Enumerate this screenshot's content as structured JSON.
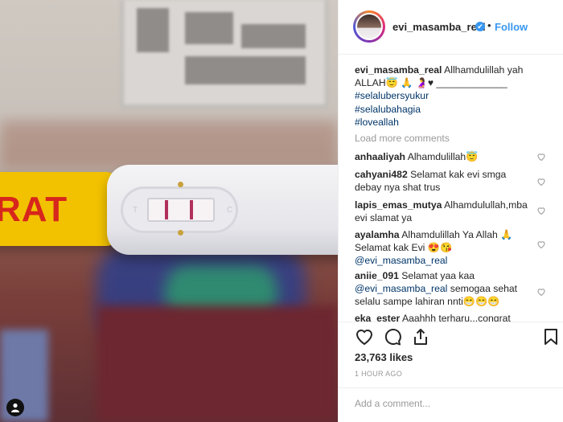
{
  "photo": {
    "test_brand_visible": "RAT",
    "window_letters": [
      "T",
      "C"
    ]
  },
  "header": {
    "username": "evi_masamba_real",
    "verified_mark": "✔",
    "separator": "•",
    "follow_label": "Follow"
  },
  "caption": {
    "username": "evi_masamba_real",
    "text_line1": "Allhamdulillah yah",
    "text_line2": "ALLAH😇 🙏 🤰♥ _____________",
    "hashtags": [
      "#selalubersyukur",
      "#selalubahagia",
      "#loveallah"
    ]
  },
  "load_more": "Load more comments",
  "comments": [
    {
      "user": "anhaaliyah",
      "line1": "Alhamdulillah😇",
      "line2": ""
    },
    {
      "user": "cahyani482",
      "line1": "Selamat kak evi smga",
      "line2": "debay nya shat trus"
    },
    {
      "user": "lapis_emas_mutya",
      "line1": "Alhamdulullah,mba",
      "line2": "evi slamat ya"
    },
    {
      "user": "ayalamha",
      "line1": "Alhamdulillah Ya Allah 🙏",
      "line2": "Selamat kak Evi 😍😘",
      "mention": "@evi_masamba_real"
    },
    {
      "user": "aniie_091",
      "line1": "Selamat yaa kaa",
      "mention": "@evi_masamba_real",
      "line2_rest": " semogaa sehat",
      "line3": "selalu sampe lahiran nnti😁😁😁"
    },
    {
      "user": "eka_ester",
      "line1": " Aaahhh terharu...congrat",
      "line2": ""
    }
  ],
  "likes": "23,763 likes",
  "time_ago": "1 HOUR AGO",
  "add_comment_placeholder": "Add a comment...",
  "colors": {
    "accent": "#3897f0",
    "text": "#262626",
    "muted": "#999999",
    "hashtag": "#003569"
  },
  "icons": [
    "heart-icon",
    "comment-icon",
    "share-icon",
    "bookmark-icon",
    "person-icon",
    "verified-icon"
  ]
}
